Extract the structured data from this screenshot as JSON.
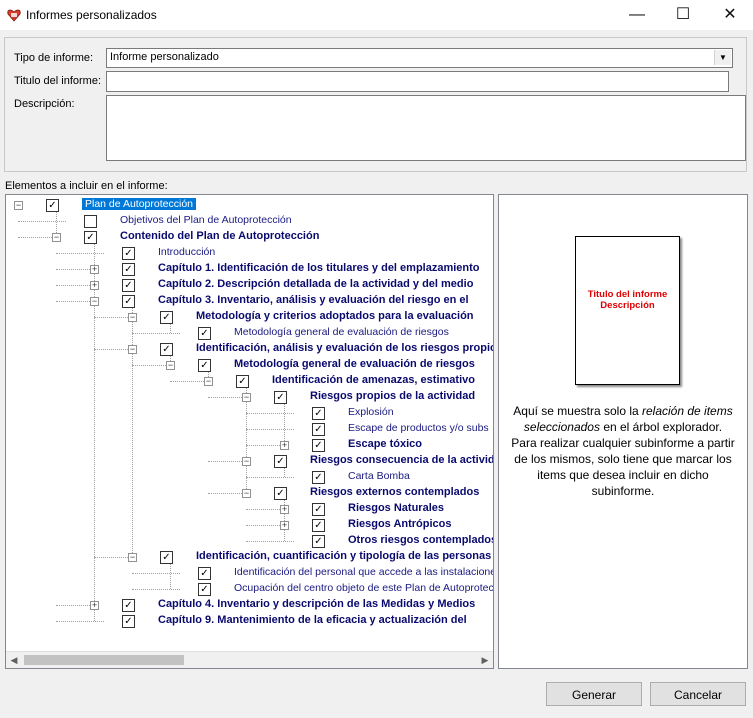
{
  "window": {
    "title": "Informes personalizados",
    "minimize_glyph": "—",
    "maximize_glyph": "☐",
    "close_glyph": "✕"
  },
  "form": {
    "tipo_label": "Tipo de informe:",
    "tipo_value": "Informe personalizado",
    "titulo_label": "Titulo del informe:",
    "titulo_value": "",
    "descripcion_label": "Descripción:",
    "descripcion_value": ""
  },
  "tree_label": "Elementos a incluir en el informe:",
  "tree": [
    {
      "label": "Plan de Autoprotección",
      "level": 0,
      "exp": "-",
      "checked": true,
      "bold": false,
      "selected": true
    },
    {
      "label": "Objetivos del Plan de Autoprotección",
      "level": 1,
      "exp": "",
      "checked": false,
      "bold": false
    },
    {
      "label": "Contenido del Plan de Autoprotección",
      "level": 1,
      "exp": "-",
      "checked": true,
      "bold": true
    },
    {
      "label": "Introducción",
      "level": 2,
      "exp": "",
      "checked": true,
      "bold": false
    },
    {
      "label": "Capítulo 1. Identificación de los titulares y del emplazamiento",
      "level": 2,
      "exp": "+",
      "checked": true,
      "bold": true
    },
    {
      "label": "Capítulo 2. Descripción detallada de la actividad y del medio",
      "level": 2,
      "exp": "+",
      "checked": true,
      "bold": true
    },
    {
      "label": "Capítulo 3. Inventario, análisis y evaluación del riesgo en el",
      "level": 2,
      "exp": "-",
      "checked": true,
      "bold": true
    },
    {
      "label": "Metodología y criterios adoptados para la evaluación",
      "level": 3,
      "exp": "-",
      "checked": true,
      "bold": true
    },
    {
      "label": "Metodología general de evaluación de riesgos",
      "level": 4,
      "exp": "",
      "checked": true,
      "bold": false
    },
    {
      "label": "Identificación, análisis y evaluación de los riesgos propios",
      "level": 3,
      "exp": "-",
      "checked": true,
      "bold": true
    },
    {
      "label": "Metodología general de evaluación de riesgos",
      "level": 4,
      "exp": "-",
      "checked": true,
      "bold": true
    },
    {
      "label": "Identificación de amenazas, estimativo",
      "level": 5,
      "exp": "-",
      "checked": true,
      "bold": true
    },
    {
      "label": "Riesgos propios de la actividad",
      "level": 6,
      "exp": "-",
      "checked": true,
      "bold": true
    },
    {
      "label": "Explosión",
      "level": 7,
      "exp": "",
      "checked": true,
      "bold": false
    },
    {
      "label": "Escape de productos y/o subs",
      "level": 7,
      "exp": "",
      "checked": true,
      "bold": false
    },
    {
      "label": "Escape tóxico",
      "level": 7,
      "exp": "+",
      "checked": true,
      "bold": true
    },
    {
      "label": "Riesgos consecuencia de la actividad",
      "level": 6,
      "exp": "-",
      "checked": true,
      "bold": true
    },
    {
      "label": "Carta Bomba",
      "level": 7,
      "exp": "",
      "checked": true,
      "bold": false
    },
    {
      "label": "Riesgos externos contemplados",
      "level": 6,
      "exp": "-",
      "checked": true,
      "bold": true
    },
    {
      "label": "Riesgos Naturales",
      "level": 7,
      "exp": "+",
      "checked": true,
      "bold": true
    },
    {
      "label": "Riesgos Antrópicos",
      "level": 7,
      "exp": "+",
      "checked": true,
      "bold": true
    },
    {
      "label": "Otros riesgos contemplados",
      "level": 7,
      "exp": "",
      "checked": true,
      "bold": true
    },
    {
      "label": "Identificación, cuantificación y tipología de las personas",
      "level": 3,
      "exp": "-",
      "checked": true,
      "bold": true
    },
    {
      "label": "Identificación del personal que accede a las instalaciones",
      "level": 4,
      "exp": "",
      "checked": true,
      "bold": false
    },
    {
      "label": "Ocupación del centro objeto de este Plan de Autoprotección",
      "level": 4,
      "exp": "",
      "checked": true,
      "bold": false
    },
    {
      "label": "Capítulo 4. Inventario y descripción de las Medidas y Medios",
      "level": 2,
      "exp": "+",
      "checked": true,
      "bold": true
    },
    {
      "label": "Capítulo 9. Mantenimiento de la eficacia y actualización del",
      "level": 2,
      "exp": "",
      "checked": true,
      "bold": true
    }
  ],
  "preview": {
    "page_line1": "Titulo del informe",
    "page_line2": "Descripción",
    "info_a": "Aquí se muestra solo la ",
    "info_em": "relación de items seleccionados",
    "info_b": " en el árbol explorador.",
    "info_c": "Para realizar cualquier subinforme a partir de los mismos, solo tiene que marcar los items que desea incluir en dicho subinforme."
  },
  "buttons": {
    "generar": "Generar",
    "cancelar": "Cancelar"
  },
  "colors": {
    "selection": "#0078d7",
    "bold_text": "#0a0a6e",
    "page_text": "#e00000"
  },
  "icons": {
    "app": "report-icon",
    "expand": "plus-box-icon",
    "collapse": "minus-box-icon",
    "check": "checkbox-icon"
  }
}
